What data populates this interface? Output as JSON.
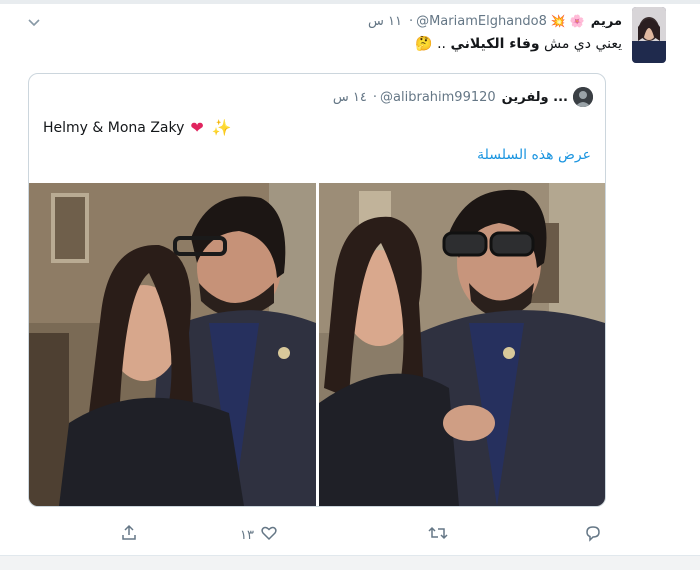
{
  "tweet": {
    "author_name": "مريم",
    "author_handle": "@MariamElghando8",
    "time": "١١ س",
    "separator": "·",
    "text_prefix": "يعني دي مش ",
    "text_bold": "وفاء الكيلاني",
    "text_suffix": " ..",
    "quote": {
      "author_name": "ولفرين ...",
      "author_handle": "@alibrahim99120",
      "time": "١٤ س",
      "separator": "·",
      "text": "Helmy & Mona Zaky",
      "link": "عرض هذه السلسلة"
    },
    "actions": {
      "like_count": "١٣"
    }
  },
  "icons": {
    "chevron": "chevron-down-icon",
    "share": "share-icon",
    "like": "heart-icon",
    "retweet": "retweet-icon",
    "reply": "reply-icon"
  },
  "colors": {
    "link": "#1b95e0",
    "muted": "#657786",
    "heart": "#e0245e"
  }
}
